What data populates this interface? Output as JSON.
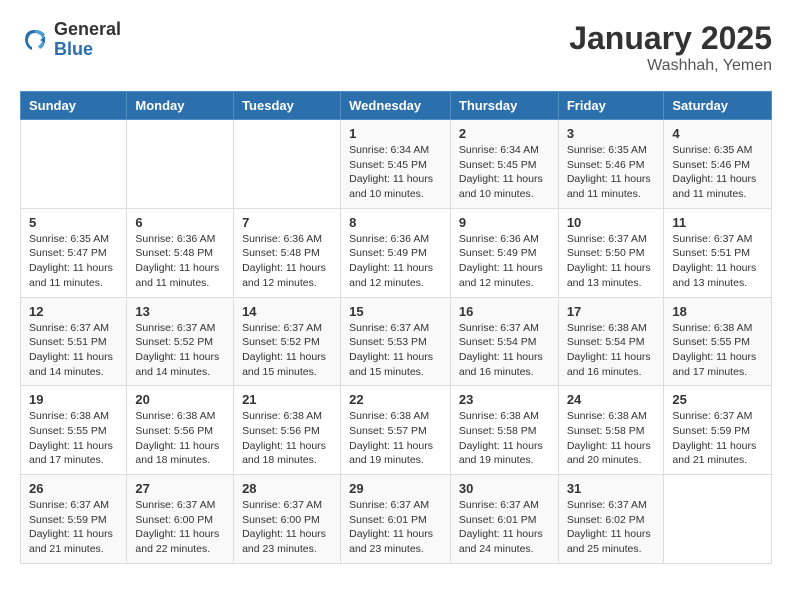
{
  "logo": {
    "general": "General",
    "blue": "Blue"
  },
  "title": {
    "month": "January 2025",
    "location": "Washhah, Yemen"
  },
  "weekdays": [
    "Sunday",
    "Monday",
    "Tuesday",
    "Wednesday",
    "Thursday",
    "Friday",
    "Saturday"
  ],
  "weeks": [
    [
      {
        "day": "",
        "info": ""
      },
      {
        "day": "",
        "info": ""
      },
      {
        "day": "",
        "info": ""
      },
      {
        "day": "1",
        "info": "Sunrise: 6:34 AM\nSunset: 5:45 PM\nDaylight: 11 hours and 10 minutes."
      },
      {
        "day": "2",
        "info": "Sunrise: 6:34 AM\nSunset: 5:45 PM\nDaylight: 11 hours and 10 minutes."
      },
      {
        "day": "3",
        "info": "Sunrise: 6:35 AM\nSunset: 5:46 PM\nDaylight: 11 hours and 11 minutes."
      },
      {
        "day": "4",
        "info": "Sunrise: 6:35 AM\nSunset: 5:46 PM\nDaylight: 11 hours and 11 minutes."
      }
    ],
    [
      {
        "day": "5",
        "info": "Sunrise: 6:35 AM\nSunset: 5:47 PM\nDaylight: 11 hours and 11 minutes."
      },
      {
        "day": "6",
        "info": "Sunrise: 6:36 AM\nSunset: 5:48 PM\nDaylight: 11 hours and 11 minutes."
      },
      {
        "day": "7",
        "info": "Sunrise: 6:36 AM\nSunset: 5:48 PM\nDaylight: 11 hours and 12 minutes."
      },
      {
        "day": "8",
        "info": "Sunrise: 6:36 AM\nSunset: 5:49 PM\nDaylight: 11 hours and 12 minutes."
      },
      {
        "day": "9",
        "info": "Sunrise: 6:36 AM\nSunset: 5:49 PM\nDaylight: 11 hours and 12 minutes."
      },
      {
        "day": "10",
        "info": "Sunrise: 6:37 AM\nSunset: 5:50 PM\nDaylight: 11 hours and 13 minutes."
      },
      {
        "day": "11",
        "info": "Sunrise: 6:37 AM\nSunset: 5:51 PM\nDaylight: 11 hours and 13 minutes."
      }
    ],
    [
      {
        "day": "12",
        "info": "Sunrise: 6:37 AM\nSunset: 5:51 PM\nDaylight: 11 hours and 14 minutes."
      },
      {
        "day": "13",
        "info": "Sunrise: 6:37 AM\nSunset: 5:52 PM\nDaylight: 11 hours and 14 minutes."
      },
      {
        "day": "14",
        "info": "Sunrise: 6:37 AM\nSunset: 5:52 PM\nDaylight: 11 hours and 15 minutes."
      },
      {
        "day": "15",
        "info": "Sunrise: 6:37 AM\nSunset: 5:53 PM\nDaylight: 11 hours and 15 minutes."
      },
      {
        "day": "16",
        "info": "Sunrise: 6:37 AM\nSunset: 5:54 PM\nDaylight: 11 hours and 16 minutes."
      },
      {
        "day": "17",
        "info": "Sunrise: 6:38 AM\nSunset: 5:54 PM\nDaylight: 11 hours and 16 minutes."
      },
      {
        "day": "18",
        "info": "Sunrise: 6:38 AM\nSunset: 5:55 PM\nDaylight: 11 hours and 17 minutes."
      }
    ],
    [
      {
        "day": "19",
        "info": "Sunrise: 6:38 AM\nSunset: 5:55 PM\nDaylight: 11 hours and 17 minutes."
      },
      {
        "day": "20",
        "info": "Sunrise: 6:38 AM\nSunset: 5:56 PM\nDaylight: 11 hours and 18 minutes."
      },
      {
        "day": "21",
        "info": "Sunrise: 6:38 AM\nSunset: 5:56 PM\nDaylight: 11 hours and 18 minutes."
      },
      {
        "day": "22",
        "info": "Sunrise: 6:38 AM\nSunset: 5:57 PM\nDaylight: 11 hours and 19 minutes."
      },
      {
        "day": "23",
        "info": "Sunrise: 6:38 AM\nSunset: 5:58 PM\nDaylight: 11 hours and 19 minutes."
      },
      {
        "day": "24",
        "info": "Sunrise: 6:38 AM\nSunset: 5:58 PM\nDaylight: 11 hours and 20 minutes."
      },
      {
        "day": "25",
        "info": "Sunrise: 6:37 AM\nSunset: 5:59 PM\nDaylight: 11 hours and 21 minutes."
      }
    ],
    [
      {
        "day": "26",
        "info": "Sunrise: 6:37 AM\nSunset: 5:59 PM\nDaylight: 11 hours and 21 minutes."
      },
      {
        "day": "27",
        "info": "Sunrise: 6:37 AM\nSunset: 6:00 PM\nDaylight: 11 hours and 22 minutes."
      },
      {
        "day": "28",
        "info": "Sunrise: 6:37 AM\nSunset: 6:00 PM\nDaylight: 11 hours and 23 minutes."
      },
      {
        "day": "29",
        "info": "Sunrise: 6:37 AM\nSunset: 6:01 PM\nDaylight: 11 hours and 23 minutes."
      },
      {
        "day": "30",
        "info": "Sunrise: 6:37 AM\nSunset: 6:01 PM\nDaylight: 11 hours and 24 minutes."
      },
      {
        "day": "31",
        "info": "Sunrise: 6:37 AM\nSunset: 6:02 PM\nDaylight: 11 hours and 25 minutes."
      },
      {
        "day": "",
        "info": ""
      }
    ]
  ]
}
